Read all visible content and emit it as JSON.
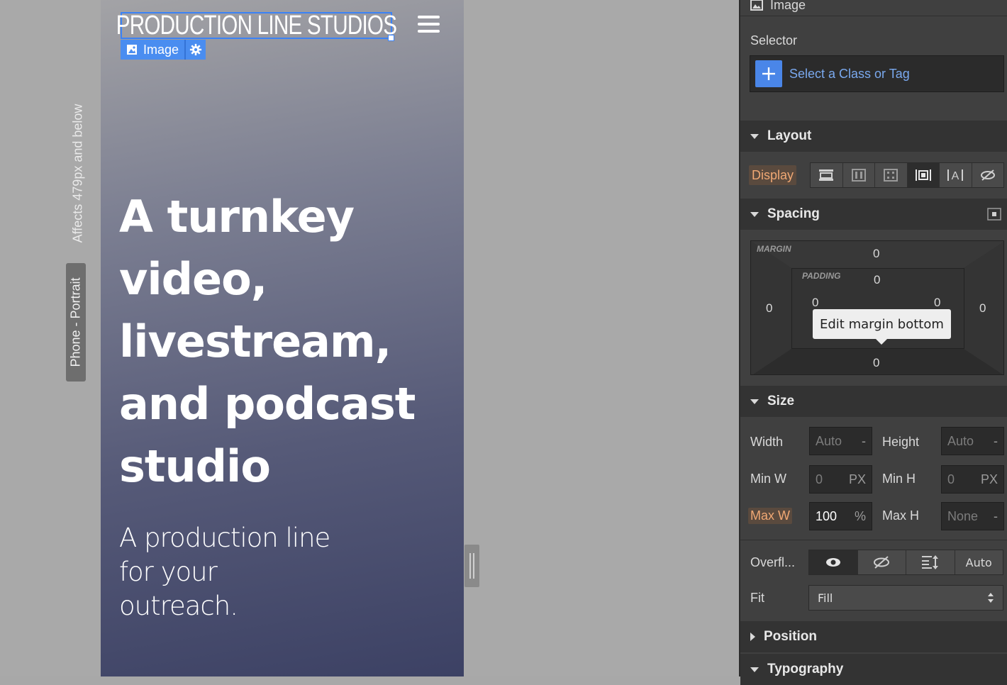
{
  "canvas": {
    "breakpoint_note": "Affects 479px and below",
    "device_label": "Phone - Portrait",
    "logo_text": "PRODUCTION LINE STUDIOS",
    "selection_tag": "Image",
    "hero_heading": "A turnkey video, livestream, and podcast studio",
    "hero_subheading": "A production line for your outreach."
  },
  "panel": {
    "element_type": "Image",
    "selector_label": "Selector",
    "selector_placeholder": "Select a Class or Tag",
    "layout": {
      "title": "Layout",
      "display_label": "Display",
      "display_options": [
        "block-icon",
        "flex-icon",
        "grid-icon",
        "inline-block-icon",
        "inline-text-icon",
        "none-icon"
      ],
      "display_active": "inline-block-icon"
    },
    "spacing": {
      "title": "Spacing",
      "margin_label": "MARGIN",
      "padding_label": "PADDING",
      "margin": {
        "top": "0",
        "right": "0",
        "bottom": "0",
        "left": "0"
      },
      "padding": {
        "top": "0",
        "right": "0",
        "bottom": "0",
        "left": "0"
      },
      "tooltip": "Edit margin bottom"
    },
    "size": {
      "title": "Size",
      "width_label": "Width",
      "width_value": "Auto",
      "width_unit": "-",
      "height_label": "Height",
      "height_value": "Auto",
      "height_unit": "-",
      "minw_label": "Min W",
      "minw_value": "0",
      "minw_unit": "PX",
      "minh_label": "Min H",
      "minh_value": "0",
      "minh_unit": "PX",
      "maxw_label": "Max W",
      "maxw_value": "100",
      "maxw_unit": "%",
      "maxh_label": "Max H",
      "maxh_value": "None",
      "maxh_unit": "-",
      "overflow_label": "Overfl...",
      "overflow_options": [
        "visible-icon",
        "hidden-icon",
        "scroll-icon"
      ],
      "overflow_auto": "Auto",
      "fit_label": "Fit",
      "fit_value": "Fill"
    },
    "position": {
      "title": "Position"
    },
    "typography": {
      "title": "Typography"
    }
  },
  "colors": {
    "accent": "#4a86e8",
    "highlight_text": "#f0a874",
    "panel_bg": "#404040"
  }
}
